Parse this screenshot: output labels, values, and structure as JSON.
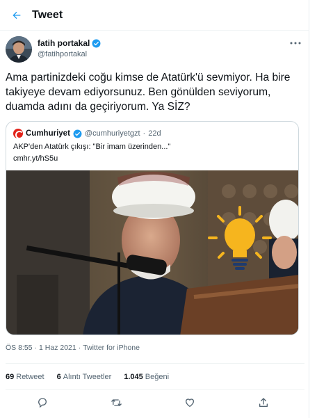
{
  "header": {
    "title": "Tweet",
    "back_icon": "arrow-left-icon",
    "accent": "#1d9bf0"
  },
  "author": {
    "name": "fatih portakal",
    "handle": "@fatihportakal",
    "verified_icon": "verified-badge-icon",
    "more_icon": "more-horizontal-icon"
  },
  "tweet": {
    "text": "Ama partinizdeki coğu kimse de Atatürk'ü sevmiyor. Ha bire takiyeye devam ediyorsunuz. Ben gönülden seviyorum, duamda adını da geçiriyorum. Ya SİZ?"
  },
  "quote": {
    "name": "Cumhuriyet",
    "handle": "@cumhuriyetgzt",
    "separator": "·",
    "time": "22d",
    "text": "AKP'den Atatürk çıkışı: \"Bir imam üzerinden...\"",
    "link": "cmhr.yt/hS5u",
    "logo_color": "#e2231a"
  },
  "meta": {
    "time": "ÖS 8:55",
    "separator": "·",
    "date": "1 Haz 2021",
    "source": "Twitter for iPhone"
  },
  "stats": {
    "retweets_count": "69",
    "retweets_label": "Retweet",
    "quotes_count": "6",
    "quotes_label": "Alıntı Tweetler",
    "likes_count": "1.045",
    "likes_label": "Beğeni"
  },
  "actions": [
    {
      "icon": "reply-icon"
    },
    {
      "icon": "retweet-icon"
    },
    {
      "icon": "like-icon"
    },
    {
      "icon": "share-icon"
    }
  ]
}
